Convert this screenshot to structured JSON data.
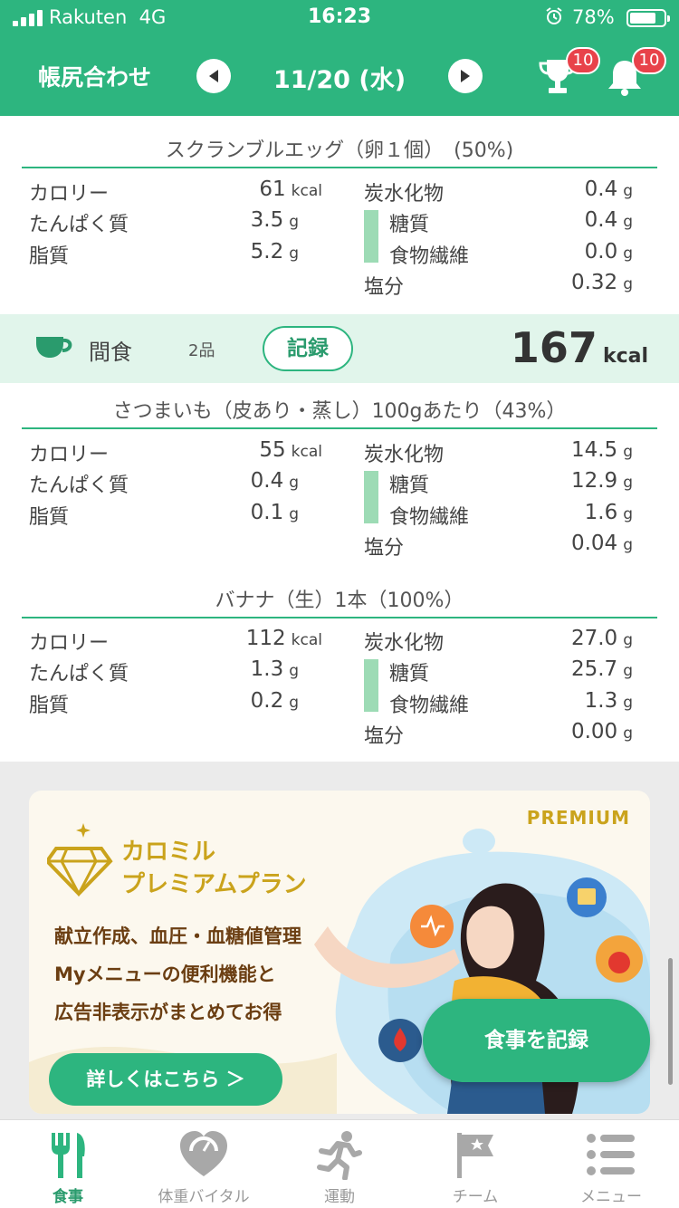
{
  "status_bar": {
    "carrier": "Rakuten",
    "network": "4G",
    "time": "16:23",
    "battery_percent": "78%",
    "battery_level": 0.78,
    "alarm_icon": "alarm-clock-icon"
  },
  "header": {
    "title": "帳尻合わせ",
    "date": "11/20 (水)",
    "prev_icon": "triangle-left-icon",
    "next_icon": "triangle-right-icon",
    "trophy_badge": "10",
    "bell_badge": "10"
  },
  "labels": {
    "calories": "カロリー",
    "protein": "たんぱく質",
    "fat": "脂質",
    "carbs": "炭水化物",
    "sugar": "糖質",
    "fiber": "食物繊維",
    "salt": "塩分",
    "kcal": "kcal",
    "g": "g"
  },
  "foods": [
    {
      "title": "スクランブルエッグ（卵１個）　(50%)",
      "calories": "61",
      "protein": "3.5",
      "fat": "5.2",
      "carbs": "0.4",
      "sugar": "0.4",
      "fiber": "0.0",
      "salt": "0.32"
    },
    {
      "title": "さつまいも（皮あり・蒸し）100gあたり（43%）",
      "calories": "55",
      "protein": "0.4",
      "fat": "0.1",
      "carbs": "14.5",
      "sugar": "12.9",
      "fiber": "1.6",
      "salt": "0.04"
    },
    {
      "title": "バナナ（生）1本（100%）",
      "calories": "112",
      "protein": "1.3",
      "fat": "0.2",
      "carbs": "27.0",
      "sugar": "25.7",
      "fiber": "1.3",
      "salt": "0.00"
    }
  ],
  "snack": {
    "icon": "teacup-icon",
    "name": "間食",
    "count": "2品",
    "record_label": "記録",
    "kcal_value": "167",
    "kcal_unit": "kcal"
  },
  "promo": {
    "premium": "PREMIUM",
    "title_line1": "カロミル",
    "title_line2": "プレミアムプラン",
    "line1": "献立作成、血圧・血糖値管理",
    "line2": "Myメニューの便利機能と",
    "line3": "広告非表示がまとめてお得",
    "button": "詳しくはこちら ＞"
  },
  "fab": {
    "label": "食事を記録"
  },
  "tabs": [
    {
      "label": "食事",
      "icon": "fork-knife-icon",
      "active": true
    },
    {
      "label": "体重バイタル",
      "icon": "heart-scale-icon",
      "active": false
    },
    {
      "label": "運動",
      "icon": "runner-icon",
      "active": false
    },
    {
      "label": "チーム",
      "icon": "flag-star-icon",
      "active": false
    },
    {
      "label": "メニュー",
      "icon": "menu-list-icon",
      "active": false
    }
  ],
  "colors": {
    "brand_green": "#2db57f",
    "snack_bg": "#e1f5eb",
    "sub_bar": "#9ddbb5",
    "badge_red": "#e8424a",
    "gold": "#caa31c",
    "brown": "#6b3e12"
  }
}
